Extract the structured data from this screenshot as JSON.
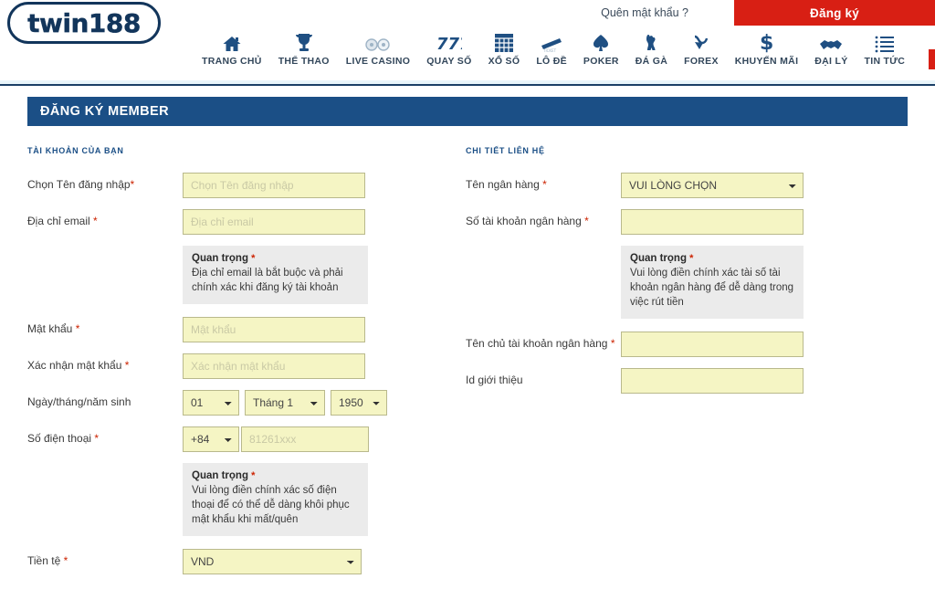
{
  "topbar": {
    "forgot_password": "Quên mật khẩu ?",
    "register_button": "Đăng ký",
    "register_color": "#d81f14"
  },
  "brand": {
    "logo_text": "twin188",
    "logo_color": "#12355b"
  },
  "nav": {
    "items": [
      {
        "label": "TRANG CHỦ",
        "icon": "home-icon"
      },
      {
        "label": "THỂ THAO",
        "icon": "trophy-icon"
      },
      {
        "label": "LIVE CASINO",
        "icon": "casino-chips-icon"
      },
      {
        "label": "QUAY SỐ",
        "icon": "slot-777-icon"
      },
      {
        "label": "XỔ SỐ",
        "icon": "lottery-grid-icon"
      },
      {
        "label": "LÔ ĐỀ",
        "icon": "ticket-icon"
      },
      {
        "label": "POKER",
        "icon": "spade-icon"
      },
      {
        "label": "ĐÁ GÀ",
        "icon": "rooster-icon"
      },
      {
        "label": "FOREX",
        "icon": "forex-arrow-icon"
      },
      {
        "label": "KHUYẾN MÃI",
        "icon": "dollar-icon"
      },
      {
        "label": "ĐẠI LÝ",
        "icon": "handshake-icon"
      },
      {
        "label": "TIN TỨC",
        "icon": "list-icon"
      }
    ]
  },
  "page": {
    "title": "ĐĂNG KÝ MEMBER",
    "title_bar_color": "#1b4f86"
  },
  "left_section": {
    "title": "TÀI KHOẢN CỦA BẠN",
    "username": {
      "label": "Chọn Tên đăng nhập",
      "required": "*",
      "placeholder": "Chọn Tên đăng nhập",
      "value": ""
    },
    "email": {
      "label": "Địa chỉ email",
      "required": "*",
      "placeholder": "Địa chỉ email",
      "value": ""
    },
    "email_notice": {
      "title": "Quan trọng",
      "required": "*",
      "body": "Địa chỉ email là bắt buộc và phải chính xác khi đăng ký tài khoản"
    },
    "password": {
      "label": "Mật khẩu",
      "required": "*",
      "placeholder": "Mật khẩu",
      "value": ""
    },
    "confirm_password": {
      "label": "Xác nhận mật khẩu",
      "required": "*",
      "placeholder": "Xác nhận mật khẩu",
      "value": ""
    },
    "birthday": {
      "label": "Ngày/tháng/năm sinh",
      "day": "01",
      "month": "Tháng 1",
      "year": "1950"
    },
    "phone": {
      "label": "Số điện thoại",
      "required": "*",
      "country_code": "+84",
      "placeholder": "81261xxx",
      "value": ""
    },
    "phone_notice": {
      "title": "Quan trọng",
      "required": "*",
      "body": "Vui lòng điền chính xác số điện thoại để có thể dễ dàng khôi phục mật khẩu khi mất/quên"
    },
    "currency": {
      "label": "Tiền tệ",
      "required": "*",
      "value": "VND"
    }
  },
  "right_section": {
    "title": "CHI TIẾT LIÊN HỆ",
    "bank_name": {
      "label": "Tên ngân hàng",
      "required": "*",
      "value": "VUI LÒNG CHỌN"
    },
    "bank_account_number": {
      "label": "Số tài khoản ngân hàng",
      "required": "*",
      "placeholder": "",
      "value": ""
    },
    "bank_notice": {
      "title": "Quan trọng",
      "required": "*",
      "body": "Vui lòng điền chính xác tài số tài khoản ngân hàng để dễ dàng trong việc rút tiền"
    },
    "bank_account_holder": {
      "label": "Tên chủ tài khoản ngân hàng",
      "required": "*",
      "placeholder": "",
      "value": ""
    },
    "referral_id": {
      "label": "Id giới thiệu",
      "required": "",
      "placeholder": "",
      "value": ""
    }
  }
}
